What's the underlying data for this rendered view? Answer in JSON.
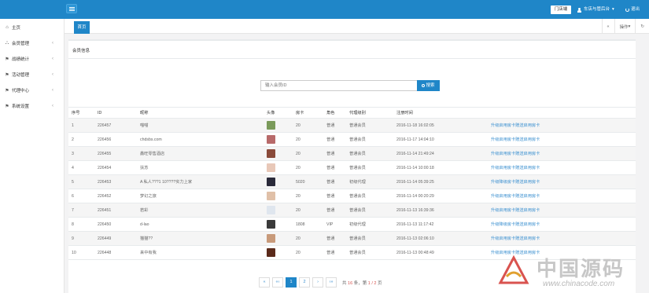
{
  "header": {
    "shop_label": "门店端",
    "user_label": "车店与管后台",
    "user_caret": "▾",
    "logout_label": "退出"
  },
  "sidebar": {
    "items": [
      {
        "icon": "home-icon",
        "glyph": "⌂",
        "label": "主页"
      },
      {
        "icon": "sitemap-icon",
        "glyph": "⛬",
        "label": "会员管理",
        "arrow": "‹"
      },
      {
        "icon": "flag-icon",
        "glyph": "⚑",
        "label": "战绩统计",
        "arrow": "‹"
      },
      {
        "icon": "flag-icon",
        "glyph": "⚑",
        "label": "活动管理",
        "arrow": "‹"
      },
      {
        "icon": "flag-icon",
        "glyph": "⚑",
        "label": "代理中心",
        "arrow": "‹"
      },
      {
        "icon": "flag-icon",
        "glyph": "⚑",
        "label": "系统设置",
        "arrow": "‹"
      }
    ]
  },
  "tabs": {
    "home_label": "首页",
    "close_all": "«",
    "ops_label": "操作",
    "ops_caret": "▾",
    "refresh": "↻"
  },
  "panel": {
    "title": "会员信息",
    "search_placeholder": "输入会员ID",
    "search_button": "搜索"
  },
  "table": {
    "headers": [
      "序号",
      "ID",
      "昵称",
      "头像",
      "房卡",
      "角色",
      "代理级别",
      "注册时间",
      ""
    ],
    "rows": [
      {
        "idx": "1",
        "id": "226457",
        "nick": "喵喵",
        "avatar": "#7a9a5a",
        "card": "20",
        "role": "普通",
        "agent": "普通会员",
        "time": "2016-11-18 16:02:05",
        "ops": "升级启用房卡赠送启用房卡"
      },
      {
        "idx": "2",
        "id": "226456",
        "nick": "chdsbs.com",
        "avatar": "#b86a6a",
        "card": "20",
        "role": "普通",
        "agent": "普通会员",
        "time": "2016-11-17 14:04:10",
        "ops": "升级启用房卡赠送启用房卡"
      },
      {
        "idx": "3",
        "id": "226455",
        "nick": "鑫旺零售酒店",
        "avatar": "#8a4a3a",
        "card": "20",
        "role": "普通",
        "agent": "普通会员",
        "time": "2016-11-14 21:49:24",
        "ops": "升级启用房卡赠送启用房卡"
      },
      {
        "idx": "4",
        "id": "226454",
        "nick": "扶苏",
        "avatar": "#e8c8b8",
        "card": "20",
        "role": "普通",
        "agent": "普通会员",
        "time": "2016-11-14 10:00:18",
        "ops": "升级启用房卡赠送启用房卡"
      },
      {
        "idx": "5",
        "id": "226453",
        "nick": "A 私人???1 10????实力上家",
        "avatar": "#2a2a3a",
        "card": "5020",
        "role": "普通",
        "agent": "初级代理",
        "time": "2016-11-14 05:39:25",
        "ops": "升级降级房卡赠送启用房卡"
      },
      {
        "idx": "6",
        "id": "226452",
        "nick": "梦幻之旅",
        "avatar": "#e0c0a8",
        "card": "20",
        "role": "普通",
        "agent": "普通会员",
        "time": "2016-11-14 00:20:29",
        "ops": "升级启用房卡赠送启用房卡"
      },
      {
        "idx": "7",
        "id": "226451",
        "nick": "若彩",
        "avatar": "#dfe6ee",
        "card": "20",
        "role": "普通",
        "agent": "普通会员",
        "time": "2016-11-13 16:39:36",
        "ops": "升级启用房卡赠送启用房卡"
      },
      {
        "idx": "8",
        "id": "226450",
        "nick": "d-lao",
        "avatar": "#3a3a3a",
        "card": "1808",
        "role": "VIP",
        "agent": "初级代理",
        "time": "2016-11-13 11:17:42",
        "ops": "升级降级房卡赠送启用房卡"
      },
      {
        "idx": "9",
        "id": "226449",
        "nick": "猫猫??",
        "avatar": "#c89a7a",
        "card": "20",
        "role": "普通",
        "agent": "普通会员",
        "time": "2016-11-13 02:06:10",
        "ops": "升级启用房卡赠送启用房卡"
      },
      {
        "idx": "10",
        "id": "226448",
        "nick": "来中有我",
        "avatar": "#5a2a1a",
        "card": "20",
        "role": "普通",
        "agent": "普通会员",
        "time": "2016-11-13 00:48:49",
        "ops": "升级启用房卡赠送启用房卡"
      }
    ]
  },
  "pager": {
    "first": "«",
    "prev": "«‹",
    "pages": [
      "1",
      "2"
    ],
    "next": "›",
    "last": "›»",
    "info_prefix": "共",
    "info_total": "16",
    "info_mid": "条，第",
    "info_page": "1 / 2",
    "info_suffix": "页"
  },
  "watermark": {
    "text": "中国源码",
    "url": "www.chinacode.com"
  }
}
